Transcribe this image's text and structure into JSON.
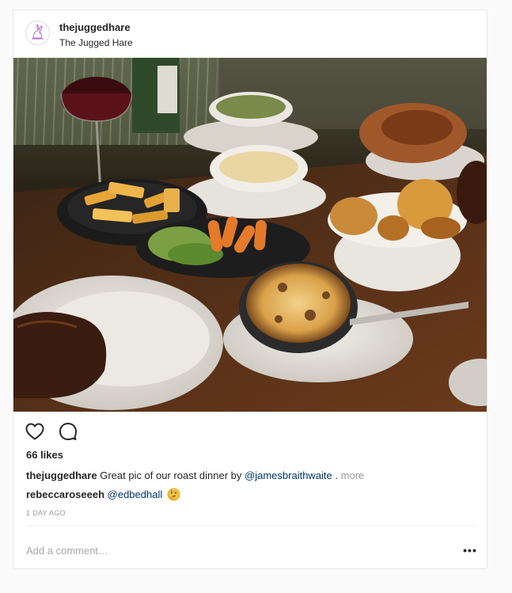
{
  "post": {
    "username": "thejuggedhare",
    "location": "The Jugged Hare",
    "likes": "66 likes",
    "caption": {
      "username": "thejuggedhare",
      "text": "Great pic of our roast dinner by",
      "mention": "@jamesbraithwaite",
      "suffix": ".",
      "more": "more"
    },
    "comments": [
      {
        "username": "rebeccaroseeeh",
        "mention": "@edbedhall",
        "emoji": "thinking-face-emoji"
      }
    ],
    "timestamp": "1 DAY AGO",
    "comment_placeholder": "Add a comment…",
    "options_glyph": "•••"
  },
  "icons": {
    "like": "heart-icon",
    "comment": "comment-bubble-icon",
    "avatar": "hare-logo-icon",
    "options": "more-options-icon"
  },
  "colors": {
    "mention": "#003569",
    "muted": "#999999",
    "text": "#262626",
    "avatar_ring": "#e2d6e8",
    "logo": "#b06ad1"
  }
}
